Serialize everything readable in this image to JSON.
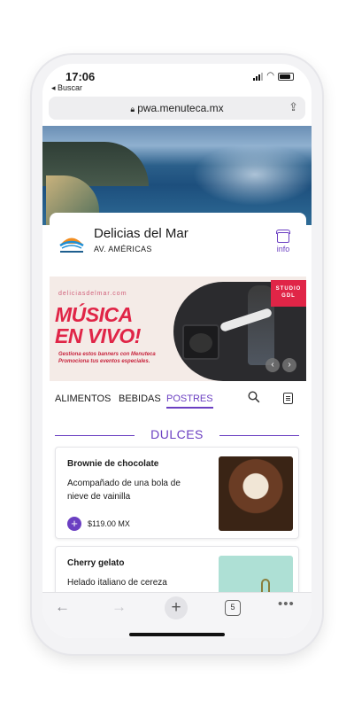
{
  "status_bar": {
    "time": "17:06",
    "back_app": "◂ Buscar"
  },
  "browser": {
    "url": "pwa.menuteca.mx",
    "tab_count": "5",
    "icons": [
      "lock-icon",
      "share-icon",
      "back-arrow-icon",
      "forward-arrow-icon",
      "plus-icon",
      "tabs-icon",
      "more-icon"
    ]
  },
  "restaurant": {
    "name": "Delicias del Mar",
    "address": "AV. AMÉRICAS",
    "info_label": "info"
  },
  "banner": {
    "url_text": "deliciasdelmar.com",
    "title_line1": "MÚSICA",
    "title_line2": "EN VIVO!",
    "subtitle_line1": "Gestiona estos banners con Menuteca",
    "subtitle_line2": "Promociona tus eventos especiales.",
    "badge_line1": "STUDIO",
    "badge_line2": "GDL",
    "prev": "‹",
    "next": "›"
  },
  "tabs": [
    {
      "label": "ALIMENTOS",
      "active": false
    },
    {
      "label": "BEBIDAS",
      "active": false
    },
    {
      "label": "POSTRES",
      "active": true
    }
  ],
  "section": {
    "title": "DULCES"
  },
  "items": [
    {
      "name": "Brownie de chocolate",
      "description": "Acompañado de una bola de nieve de vainilla",
      "price": "$119.00 MX"
    },
    {
      "name": "Cherry gelato",
      "description": "Helado italiano de cereza"
    }
  ],
  "colors": {
    "accent": "#6b3fc2",
    "banner_red": "#e02547",
    "banner_bg": "#f4ebe7"
  }
}
